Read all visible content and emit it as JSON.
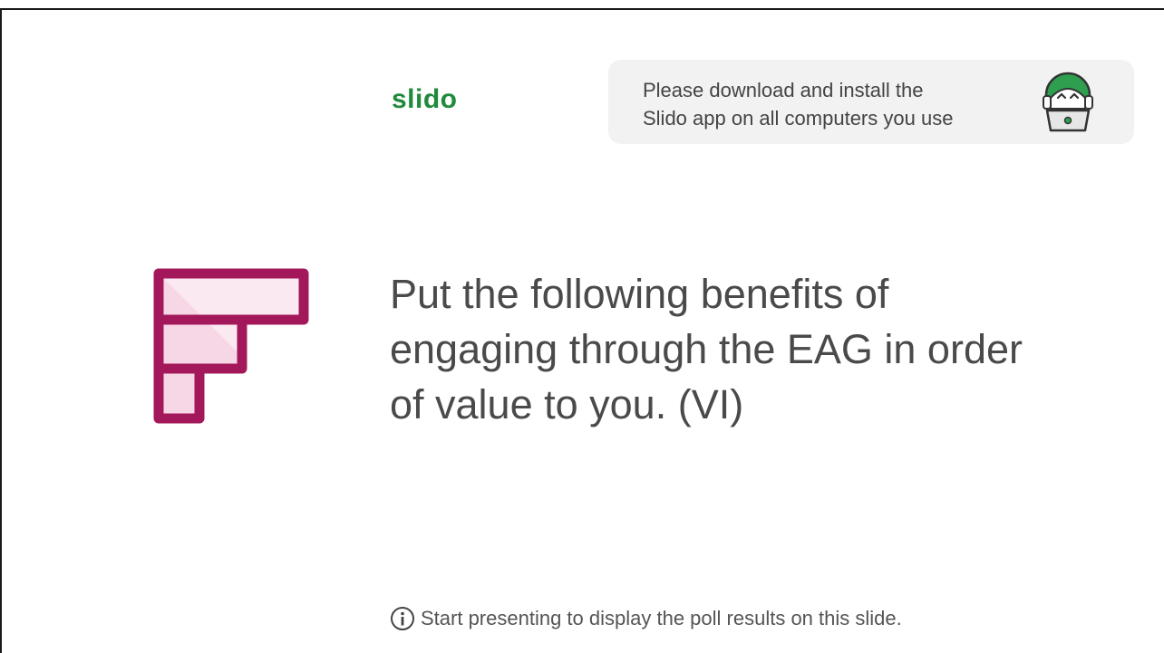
{
  "brand": {
    "logo_text": "slido",
    "color": "#1f8a3c"
  },
  "banner": {
    "line1": "Please download and install the",
    "line2": "Slido app on all computers you use",
    "mascot_icon": "slido-mascot-laptop-icon"
  },
  "question": {
    "icon": "ranking-poll-icon",
    "icon_color": "#a3185b",
    "line1": "Put the following benefits of",
    "line2": "engaging through the EAG in order",
    "line3": "of value to you. (VI)"
  },
  "hint": {
    "icon": "info-icon",
    "text": "Start presenting to display the poll results on this slide."
  }
}
